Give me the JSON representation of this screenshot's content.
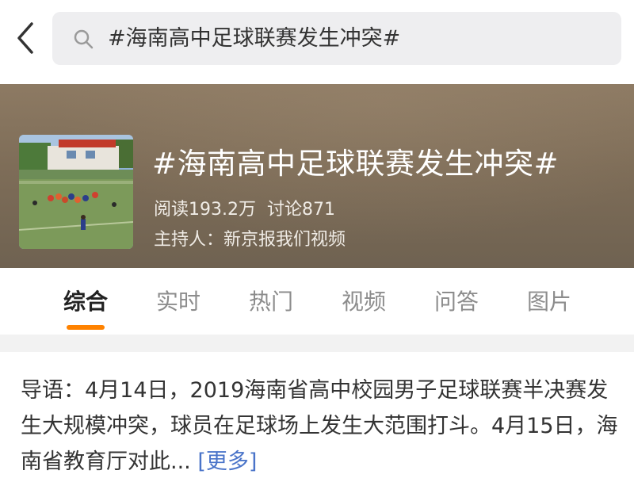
{
  "search": {
    "query": "#海南高中足球联赛发生冲突#"
  },
  "topic": {
    "title": "#海南高中足球联赛发生冲突#",
    "reads": "阅读193.2万",
    "discussions": "讨论871",
    "host": "主持人：新京报我们视频"
  },
  "tabs": [
    {
      "label": "综合",
      "active": true
    },
    {
      "label": "实时",
      "active": false
    },
    {
      "label": "热门",
      "active": false
    },
    {
      "label": "视频",
      "active": false
    },
    {
      "label": "问答",
      "active": false
    },
    {
      "label": "图片",
      "active": false
    }
  ],
  "guide": {
    "text": "导语：4月14日，2019海南省高中校园男子足球联赛半决赛发生大规模冲突，球员在足球场上发生大范围打斗。4月15日，海南省教育厅对此...",
    "more_label": "[更多]"
  },
  "colors": {
    "accent": "#ff8200",
    "link": "#4a74c9",
    "banner": "#7e6d58"
  },
  "icons": {
    "back": "chevron-left-icon",
    "search": "search-icon"
  }
}
